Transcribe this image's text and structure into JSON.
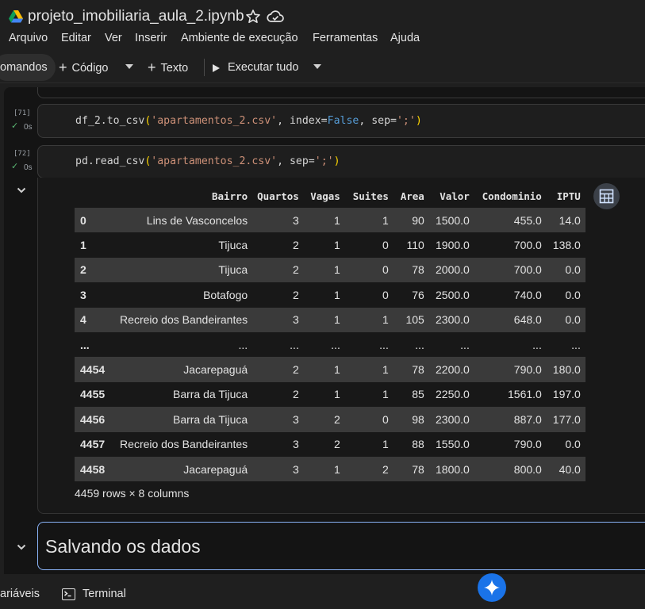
{
  "header": {
    "title": "projeto_imobiliaria_aula_2.ipynb",
    "icons": {
      "drive": "google-drive-icon",
      "star": "star-icon",
      "cloud": "cloud-saved-icon"
    }
  },
  "menu": [
    "Arquivo",
    "Editar",
    "Ver",
    "Inserir",
    "Ambiente de execução",
    "Ferramentas",
    "Ajuda"
  ],
  "toolbar": {
    "commands_label": "omandos",
    "code_label": "Código",
    "text_label": "Texto",
    "run_all_label": "Executar tudo"
  },
  "cells": [
    {
      "exec_count": "[71]",
      "exec_time": "0s",
      "code": {
        "fn": "df_2.to_csv",
        "arg1": "'apartamentos_2.csv'",
        "kw1": "index=",
        "kw1val": "False",
        "kw2": "sep=",
        "kw2val": "';'"
      }
    },
    {
      "exec_count": "[72]",
      "exec_time": "0s",
      "code": {
        "fn": "pd.read_csv",
        "arg1": "'apartamentos_2.csv'",
        "kw2": "sep=",
        "kw2val": "';'"
      }
    }
  ],
  "dataframe": {
    "columns": [
      "Bairro",
      "Quartos",
      "Vagas",
      "Suites",
      "Area",
      "Valor",
      "Condominio",
      "IPTU"
    ],
    "rows": [
      [
        "0",
        "Lins de Vasconcelos",
        "3",
        "1",
        "1",
        "90",
        "1500.0",
        "455.0",
        "14.0"
      ],
      [
        "1",
        "Tijuca",
        "2",
        "1",
        "0",
        "110",
        "1900.0",
        "700.0",
        "138.0"
      ],
      [
        "2",
        "Tijuca",
        "2",
        "1",
        "0",
        "78",
        "2000.0",
        "700.0",
        "0.0"
      ],
      [
        "3",
        "Botafogo",
        "2",
        "1",
        "0",
        "76",
        "2500.0",
        "740.0",
        "0.0"
      ],
      [
        "4",
        "Recreio dos Bandeirantes",
        "3",
        "1",
        "1",
        "105",
        "2300.0",
        "648.0",
        "0.0"
      ],
      [
        "...",
        "...",
        "...",
        "...",
        "...",
        "...",
        "...",
        "...",
        "..."
      ],
      [
        "4454",
        "Jacarepaguá",
        "2",
        "1",
        "1",
        "78",
        "2200.0",
        "790.0",
        "180.0"
      ],
      [
        "4455",
        "Barra da Tijuca",
        "2",
        "1",
        "1",
        "85",
        "2250.0",
        "1561.0",
        "197.0"
      ],
      [
        "4456",
        "Barra da Tijuca",
        "3",
        "2",
        "0",
        "98",
        "2300.0",
        "887.0",
        "177.0"
      ],
      [
        "4457",
        "Recreio dos Bandeirantes",
        "3",
        "2",
        "1",
        "88",
        "1550.0",
        "790.0",
        "0.0"
      ],
      [
        "4458",
        "Jacarepaguá",
        "3",
        "1",
        "2",
        "78",
        "1800.0",
        "800.0",
        "40.0"
      ]
    ],
    "shape_label": "4459 rows × 8 columns"
  },
  "text_cell": {
    "heading": "Salvando os dados"
  },
  "statusbar": {
    "variables_label": "/ariáveis",
    "terminal_label": "Terminal"
  },
  "colors": {
    "accent": "#8ab4f8",
    "check": "#5bb974",
    "string": "#ce9178",
    "keyword": "#569cd6"
  }
}
